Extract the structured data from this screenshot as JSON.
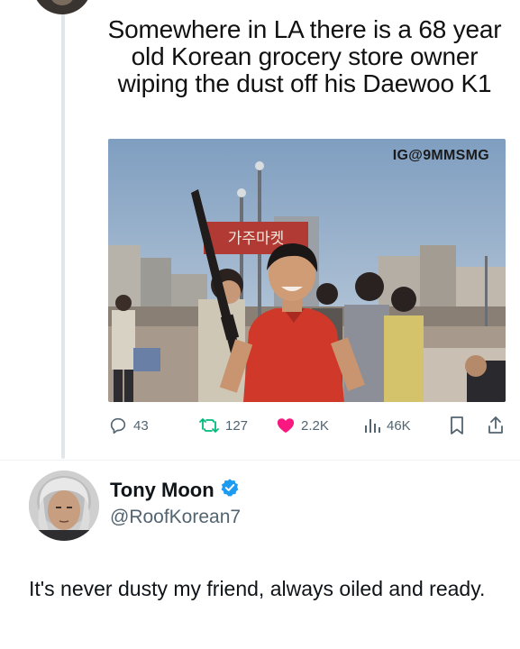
{
  "meme": {
    "caption": "Somewhere in LA there is a 68 year old Korean grocery store owner wiping the dust off his Daewoo K1",
    "photo_tag": "IG@9MMSMG",
    "banner_text": "가주마켓"
  },
  "actions": {
    "replies": "43",
    "retweets": "127",
    "likes": "2.2K",
    "views": "46K"
  },
  "reply": {
    "author_name": "Tony Moon",
    "author_handle": "@RoofKorean7",
    "text": "It's never dusty my friend, always oiled and ready."
  },
  "colors": {
    "icon_gray": "#536471",
    "like_red": "#f91880",
    "verified_blue": "#1d9bf0",
    "retweet_green": "#00ba7c"
  },
  "icons": [
    "reply-icon",
    "retweet-icon",
    "heart-icon",
    "views-icon",
    "bookmark-icon",
    "share-icon",
    "verified-badge-icon"
  ]
}
